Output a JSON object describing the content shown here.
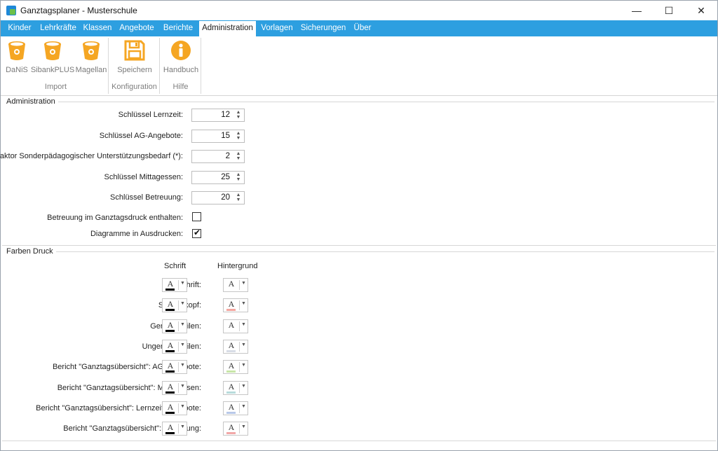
{
  "window": {
    "title": "Ganztagsplaner - Musterschule",
    "minimize_icon": "minimize-icon",
    "maximize_icon": "maximize-icon",
    "close_icon": "close-icon"
  },
  "tabs": [
    {
      "label": "Kinder",
      "active": false
    },
    {
      "label": "Lehrkräfte",
      "active": false
    },
    {
      "label": "Klassen",
      "active": false
    },
    {
      "label": "Angebote",
      "active": false
    },
    {
      "label": "Berichte",
      "active": false
    },
    {
      "label": "Administration",
      "active": true
    },
    {
      "label": "Vorlagen",
      "active": false
    },
    {
      "label": "Sicherungen",
      "active": false
    },
    {
      "label": "Über",
      "active": false
    }
  ],
  "ribbon": {
    "groups": [
      {
        "label": "Import",
        "buttons": [
          {
            "label": "DaNiS",
            "icon": "bucket-icon"
          },
          {
            "label": "SibankPLUS",
            "icon": "bucket-icon"
          },
          {
            "label": "Magellan",
            "icon": "bucket-icon"
          }
        ]
      },
      {
        "label": "Konfiguration",
        "buttons": [
          {
            "label": "Speichern",
            "icon": "floppy-disk-icon"
          }
        ]
      },
      {
        "label": "Hilfe",
        "buttons": [
          {
            "label": "Handbuch",
            "icon": "info-icon"
          }
        ]
      }
    ],
    "icon_color": "#f5a623"
  },
  "administration": {
    "header": "Administration",
    "fields": [
      {
        "label": "Schlüssel Lernzeit:",
        "value": "12"
      },
      {
        "label": "Schlüssel AG-Angebote:",
        "value": "15"
      },
      {
        "label": "Faktor Sonderpädagogischer Unterstützungsbedarf (*):",
        "value": "2"
      },
      {
        "label": "Schlüssel Mittagessen:",
        "value": "25"
      },
      {
        "label": "Schlüssel Betreuung:",
        "value": "20"
      }
    ],
    "checkboxes": [
      {
        "label": "Betreuung im Ganztagsdruck enthalten:",
        "checked": false
      },
      {
        "label": "Diagramme in Ausdrucken:",
        "checked": true
      }
    ]
  },
  "farben": {
    "header": "Farben Druck",
    "col_schrift": "Schrift",
    "col_hintergrund": "Hintergrund",
    "picker_glyph": "A",
    "rows": [
      {
        "label": "Überschrift:",
        "schrift": "#000000",
        "hintergrund": "#ffffff"
      },
      {
        "label": "Spaltenkopf:",
        "schrift": "#000000",
        "hintergrund": "#f4a6a0"
      },
      {
        "label": "Gerade Zeilen:",
        "schrift": "#000000",
        "hintergrund": "#ffffff"
      },
      {
        "label": "Ungerade Zeilen:",
        "schrift": "#000000",
        "hintergrund": "#d8dde6"
      },
      {
        "label": "Bericht \"Ganztagsübersicht\": AG-Angebote:",
        "schrift": "#000000",
        "hintergrund": "#c8e6a8"
      },
      {
        "label": "Bericht \"Ganztagsübersicht\": Mittagessen:",
        "schrift": "#000000",
        "hintergrund": "#b8dcdc"
      },
      {
        "label": "Bericht \"Ganztagsübersicht\": Lernzeit-Angebote:",
        "schrift": "#000000",
        "hintergrund": "#b8c8e8"
      },
      {
        "label": "Bericht \"Ganztagsübersicht\": Betreuung:",
        "schrift": "#000000",
        "hintergrund": "#f2a8a8"
      }
    ]
  }
}
